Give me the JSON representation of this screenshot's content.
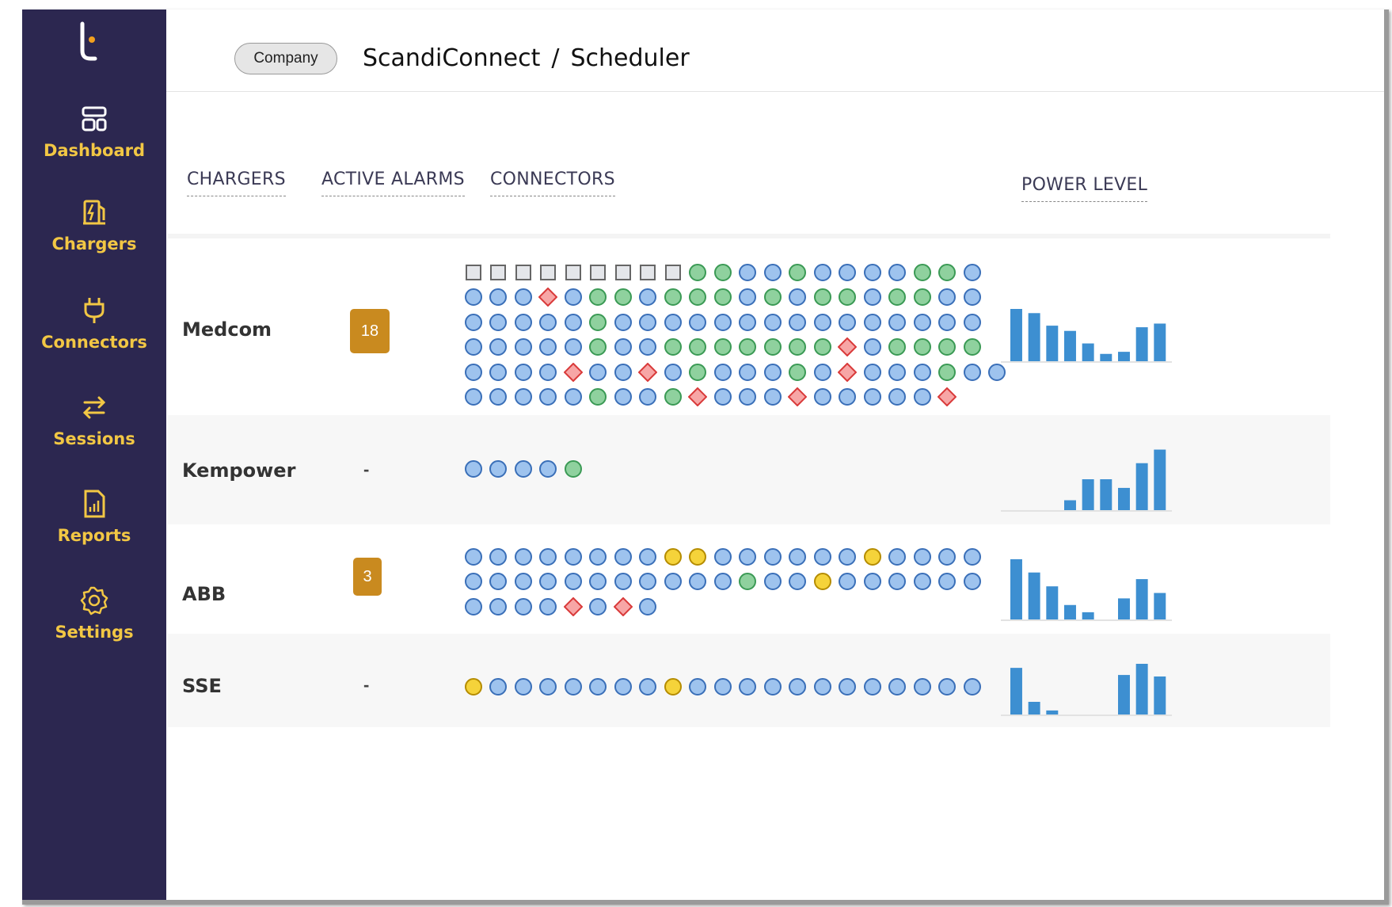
{
  "sidebar": {
    "items": [
      {
        "label": "Dashboard",
        "icon": "dashboard-icon"
      },
      {
        "label": "Chargers",
        "icon": "charger-station-icon"
      },
      {
        "label": "Connectors",
        "icon": "plug-icon"
      },
      {
        "label": "Sessions",
        "icon": "swap-arrows-icon"
      },
      {
        "label": "Reports",
        "icon": "report-document-icon"
      },
      {
        "label": "Settings",
        "icon": "gear-icon"
      }
    ]
  },
  "header": {
    "company_pill": "Company",
    "breadcrumb": [
      "ScandiConnect",
      "Scheduler"
    ],
    "separator": "/"
  },
  "columns": {
    "chargers": "CHARGERS",
    "alarms": "ACTIVE ALARMS",
    "connectors": "CONNECTORS",
    "power": "POWER LEVEL"
  },
  "colors": {
    "sidebar_bg": "#2c2750",
    "sidebar_text": "#f2c744",
    "alarm_badge": "#c98a1f",
    "connector_blue": "#9ec3ee",
    "connector_blue_stroke": "#3a6fb8",
    "connector_green": "#8fd19e",
    "connector_green_stroke": "#3b9a55",
    "connector_yellow": "#f5d33a",
    "connector_yellow_stroke": "#b58c00",
    "connector_red": "#f7a6a6",
    "connector_red_stroke": "#d93a3a",
    "connector_gray": "#e4e6ea",
    "connector_gray_stroke": "#666666",
    "power_bar": "#3d8fd1"
  },
  "connector_legend_codes": {
    "B": "blue-circle",
    "G": "green-circle",
    "Y": "yellow-circle",
    "R": "red-diamond",
    "S": "gray-square"
  },
  "chargers": [
    {
      "name": "Medcom",
      "alarms": "18",
      "connectors": [
        "SSSSSSSSSGGBBGBBBBGGB",
        "BBBRBGGBGGGBGBGGBGGBB",
        "BBBBBGBBBBBBBBBBBBBBB",
        "BBBBBGBBGGGGGGGRBGGGG",
        "BBBBRBBRBGBBBGBRBBBGBB",
        "BBBBBGBBGRBBBRBBBBBR"
      ],
      "power_levels": [
        1.0,
        0.92,
        0.68,
        0.58,
        0.34,
        0.14,
        0.18,
        0.65,
        0.72
      ]
    },
    {
      "name": "Kempower",
      "alarms": "-",
      "connectors": [
        "BBBBG"
      ],
      "power_levels": [
        0,
        0,
        0,
        0.16,
        0.5,
        0.5,
        0.36,
        0.76,
        0.98
      ]
    },
    {
      "name": "ABB",
      "alarms": "3",
      "connectors": [
        "BBBBBBBBYYBBBBBBYBBBB",
        "BBBBBBBBBBBGBBYBBBBBB",
        "BBBBRBRB"
      ],
      "power_levels": [
        1.0,
        0.78,
        0.55,
        0.24,
        0.12,
        0,
        0.35,
        0.67,
        0.44
      ]
    },
    {
      "name": "SSE",
      "alarms": "-",
      "connectors": [
        "YBBBBBBBYBBBBBBBBBBBB"
      ],
      "power_levels": [
        0.92,
        0.25,
        0.08,
        0,
        0,
        0,
        0.78,
        1.0,
        0.75
      ]
    }
  ]
}
